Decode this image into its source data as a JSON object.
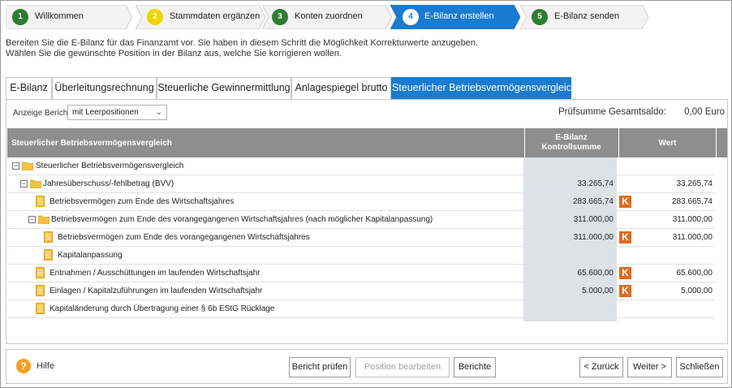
{
  "steps": [
    {
      "num": "1",
      "label": "Willkommen",
      "color": "#2e7d32"
    },
    {
      "num": "2",
      "label": "Stammdaten ergänzen",
      "color": "#f0d400"
    },
    {
      "num": "3",
      "label": "Konten zuordnen",
      "color": "#2e7d32"
    },
    {
      "num": "4",
      "label": "E-Bilanz erstellen",
      "color": "#1a7bd0",
      "active": true
    },
    {
      "num": "5",
      "label": "E-Bilanz senden",
      "color": "#2e7d32"
    }
  ],
  "intro": {
    "line1": "Bereiten Sie die E-Bilanz für das Finanzamt vor. Sie haben in diesem Schritt die Möglichkeit Korrekturwerte anzugeben.",
    "line2": "Wählen Sie die gewünschte Position in der Bilanz aus, welche Sie korrigieren wollen."
  },
  "tabs": [
    "E-Bilanz",
    "Überleitungsrechnung",
    "Steuerliche Gewinnermittlung",
    "Anlagespiegel brutto",
    "Steuerlicher Betriebsvermögensvergleich"
  ],
  "report": {
    "anzeige_label": "Anzeige Bericht:",
    "anzeige_value": "mit Leerpositionen",
    "pruefsumme_label": "Prüfsumme Gesamtsaldo:",
    "pruefsumme_value": "0,00  Euro"
  },
  "table": {
    "col_name": "Steuerlicher Betriebsvermögensvergleich",
    "col_k_line1": "E-Bilanz",
    "col_k_line2": "Kontrollsumme",
    "col_w": "Wert",
    "rows": [
      {
        "name": "Steuerlicher Betriebsvermögensvergleich",
        "k": "",
        "w": "",
        "badge": ""
      },
      {
        "name": "Jahresüberschuss/-fehlbetrag (BVV)",
        "k": "33.265,74",
        "w": "33.265,74",
        "badge": ""
      },
      {
        "name": "Betriebsvermögen zum Ende des Wirtschaftsjahres",
        "k": "283.665,74",
        "w": "283.665,74",
        "badge": "K"
      },
      {
        "name": "Betriebsvermögen zum Ende des vorangegangenen Wirtschaftsjahres (nach möglicher Kapitalanpassung)",
        "k": "311.000,00",
        "w": "311.000,00",
        "badge": ""
      },
      {
        "name": "Betriebsvermögen zum Ende des vorangegangenen Wirtschaftsjahres",
        "k": "311.000,00",
        "w": "311.000,00",
        "badge": "K"
      },
      {
        "name": "Kapitalanpassung",
        "k": "",
        "w": "",
        "badge": ""
      },
      {
        "name": "Entnahmen / Ausschüttungen im laufenden Wirtschaftsjahr",
        "k": "65.600,00",
        "w": "65.600,00",
        "badge": "K"
      },
      {
        "name": "Einlagen / Kapitalzuführungen im laufenden Wirtschaftsjahr",
        "k": "5.000,00",
        "w": "5.000,00",
        "badge": "K"
      },
      {
        "name": "Kapitaländerung durch Übertragung einer § 6b EStG Rücklage",
        "k": "",
        "w": "",
        "badge": ""
      }
    ]
  },
  "footer": {
    "help": "Hilfe",
    "bericht_pruefen": "Bericht prüfen",
    "position_bearbeiten": "Position bearbeiten",
    "berichte": "Berichte",
    "zurueck": "< Zurück",
    "weiter": "Weiter >",
    "schliessen": "Schließen"
  },
  "colors": {
    "accent": "#1a7bd0",
    "badge": "#e06b1f",
    "header": "#8e8e8e",
    "folder": "#f4c242"
  }
}
